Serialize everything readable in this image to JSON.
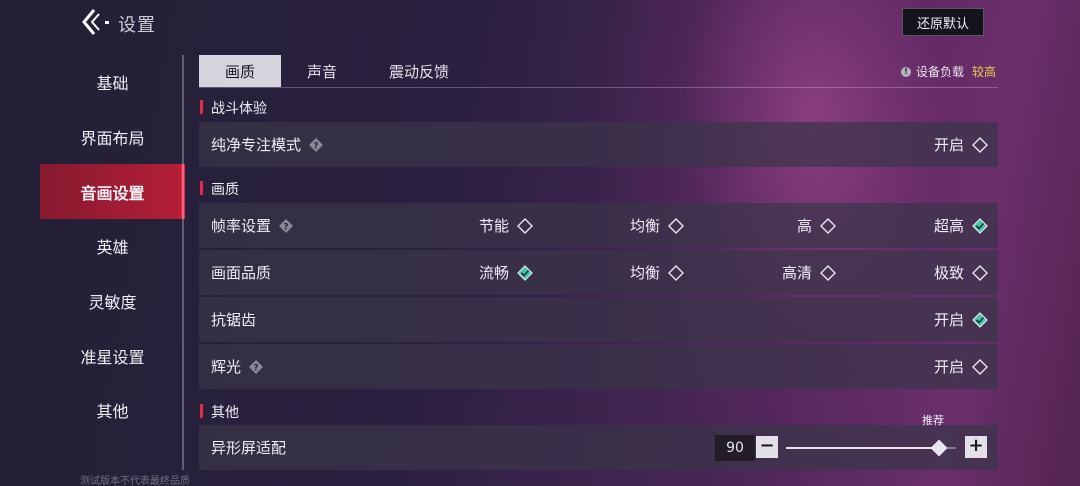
{
  "header": {
    "title": "设置",
    "restore_label": "还原默认"
  },
  "sidebar": {
    "items": [
      {
        "label": "基础"
      },
      {
        "label": "界面布局"
      },
      {
        "label": "音画设置"
      },
      {
        "label": "英雄"
      },
      {
        "label": "灵敏度"
      },
      {
        "label": "准星设置"
      },
      {
        "label": "其他"
      }
    ],
    "active_index": 2
  },
  "tabs": [
    {
      "label": "画质"
    },
    {
      "label": "声音"
    },
    {
      "label": "震动反馈"
    }
  ],
  "device_load": {
    "icon": "info-icon",
    "label": "设备负载",
    "value": "较高"
  },
  "sections": {
    "combat": {
      "title": "战斗体验",
      "pure_mode": {
        "label": "纯净专注模式",
        "option": "开启",
        "checked": false
      }
    },
    "quality": {
      "title": "画质",
      "frame_rate": {
        "label": "帧率设置",
        "options": [
          "节能",
          "均衡",
          "高",
          "超高"
        ],
        "selected": "超高"
      },
      "image_quality": {
        "label": "画面品质",
        "options": [
          "流畅",
          "均衡",
          "高清",
          "极致"
        ],
        "selected": "流畅"
      },
      "antialias": {
        "label": "抗锯齿",
        "option": "开启",
        "checked": true
      },
      "glow": {
        "label": "辉光",
        "option": "开启",
        "checked": false
      }
    },
    "other": {
      "title": "其他",
      "notch": {
        "label": "异形屏适配",
        "value": "90",
        "recommend_label": "推荐",
        "fill_fraction": 0.9
      }
    }
  },
  "footer_note": "测试版本不代表最终品质",
  "colors": {
    "accent": "#e9274a",
    "checked": "#3fc7a8",
    "load_warning": "#f2c94c"
  }
}
